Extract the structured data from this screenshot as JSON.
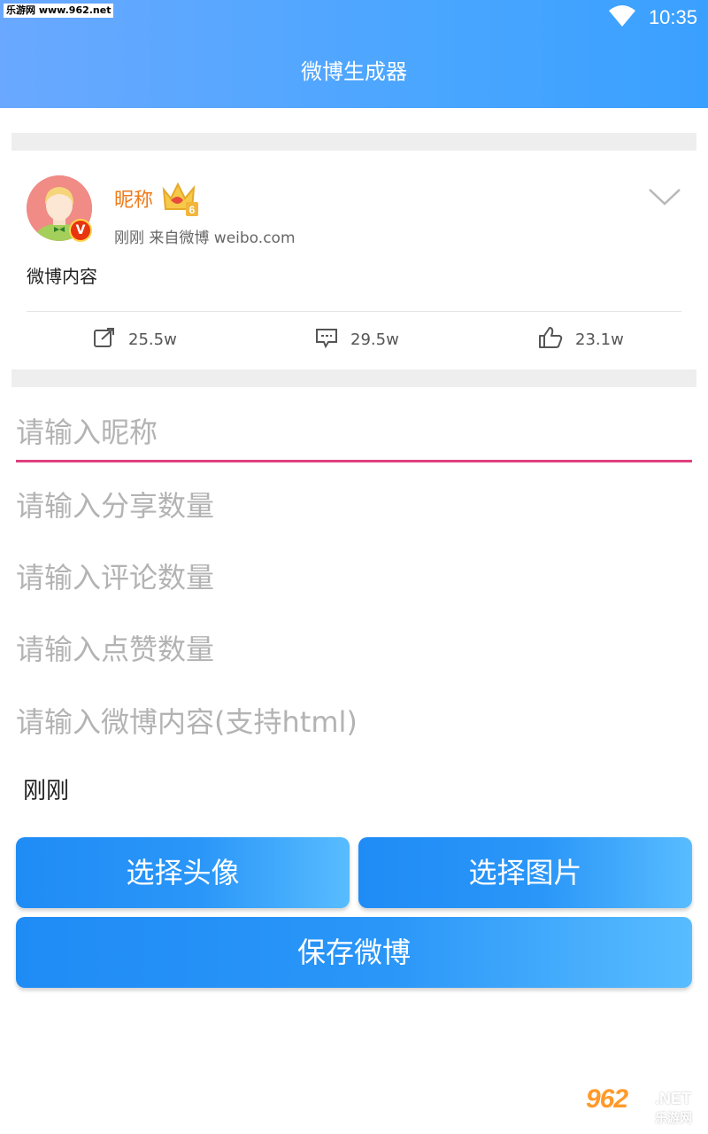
{
  "status_bar": {
    "watermark": "乐游网 www.962.net",
    "time": "10:35",
    "icons": [
      "wifi-icon"
    ]
  },
  "app_bar": {
    "title": "微博生成器",
    "color_start": "#6aa8ff",
    "color_end": "#3aa0ff"
  },
  "preview": {
    "nickname": "昵称",
    "level_badge": "6",
    "verified_badge": "V",
    "meta": "刚刚  来自微博 weibo.com",
    "content": "微博内容",
    "share_count": "25.5w",
    "comment_count": "29.5w",
    "like_count": "23.1w",
    "nickname_color": "#ef7a1a"
  },
  "form": {
    "nickname_placeholder": "请输入昵称",
    "share_placeholder": "请输入分享数量",
    "comment_placeholder": "请输入评论数量",
    "like_placeholder": "请输入点赞数量",
    "content_placeholder": "请输入微博内容(支持html)",
    "time_value": "刚刚",
    "active_underline_color": "#e0407c"
  },
  "buttons": {
    "choose_avatar": "选择头像",
    "choose_image": "选择图片",
    "save": "保存微博"
  },
  "watermark_bottom": {
    "logo": "962",
    "net": ".NET",
    "cn": "乐游网"
  }
}
